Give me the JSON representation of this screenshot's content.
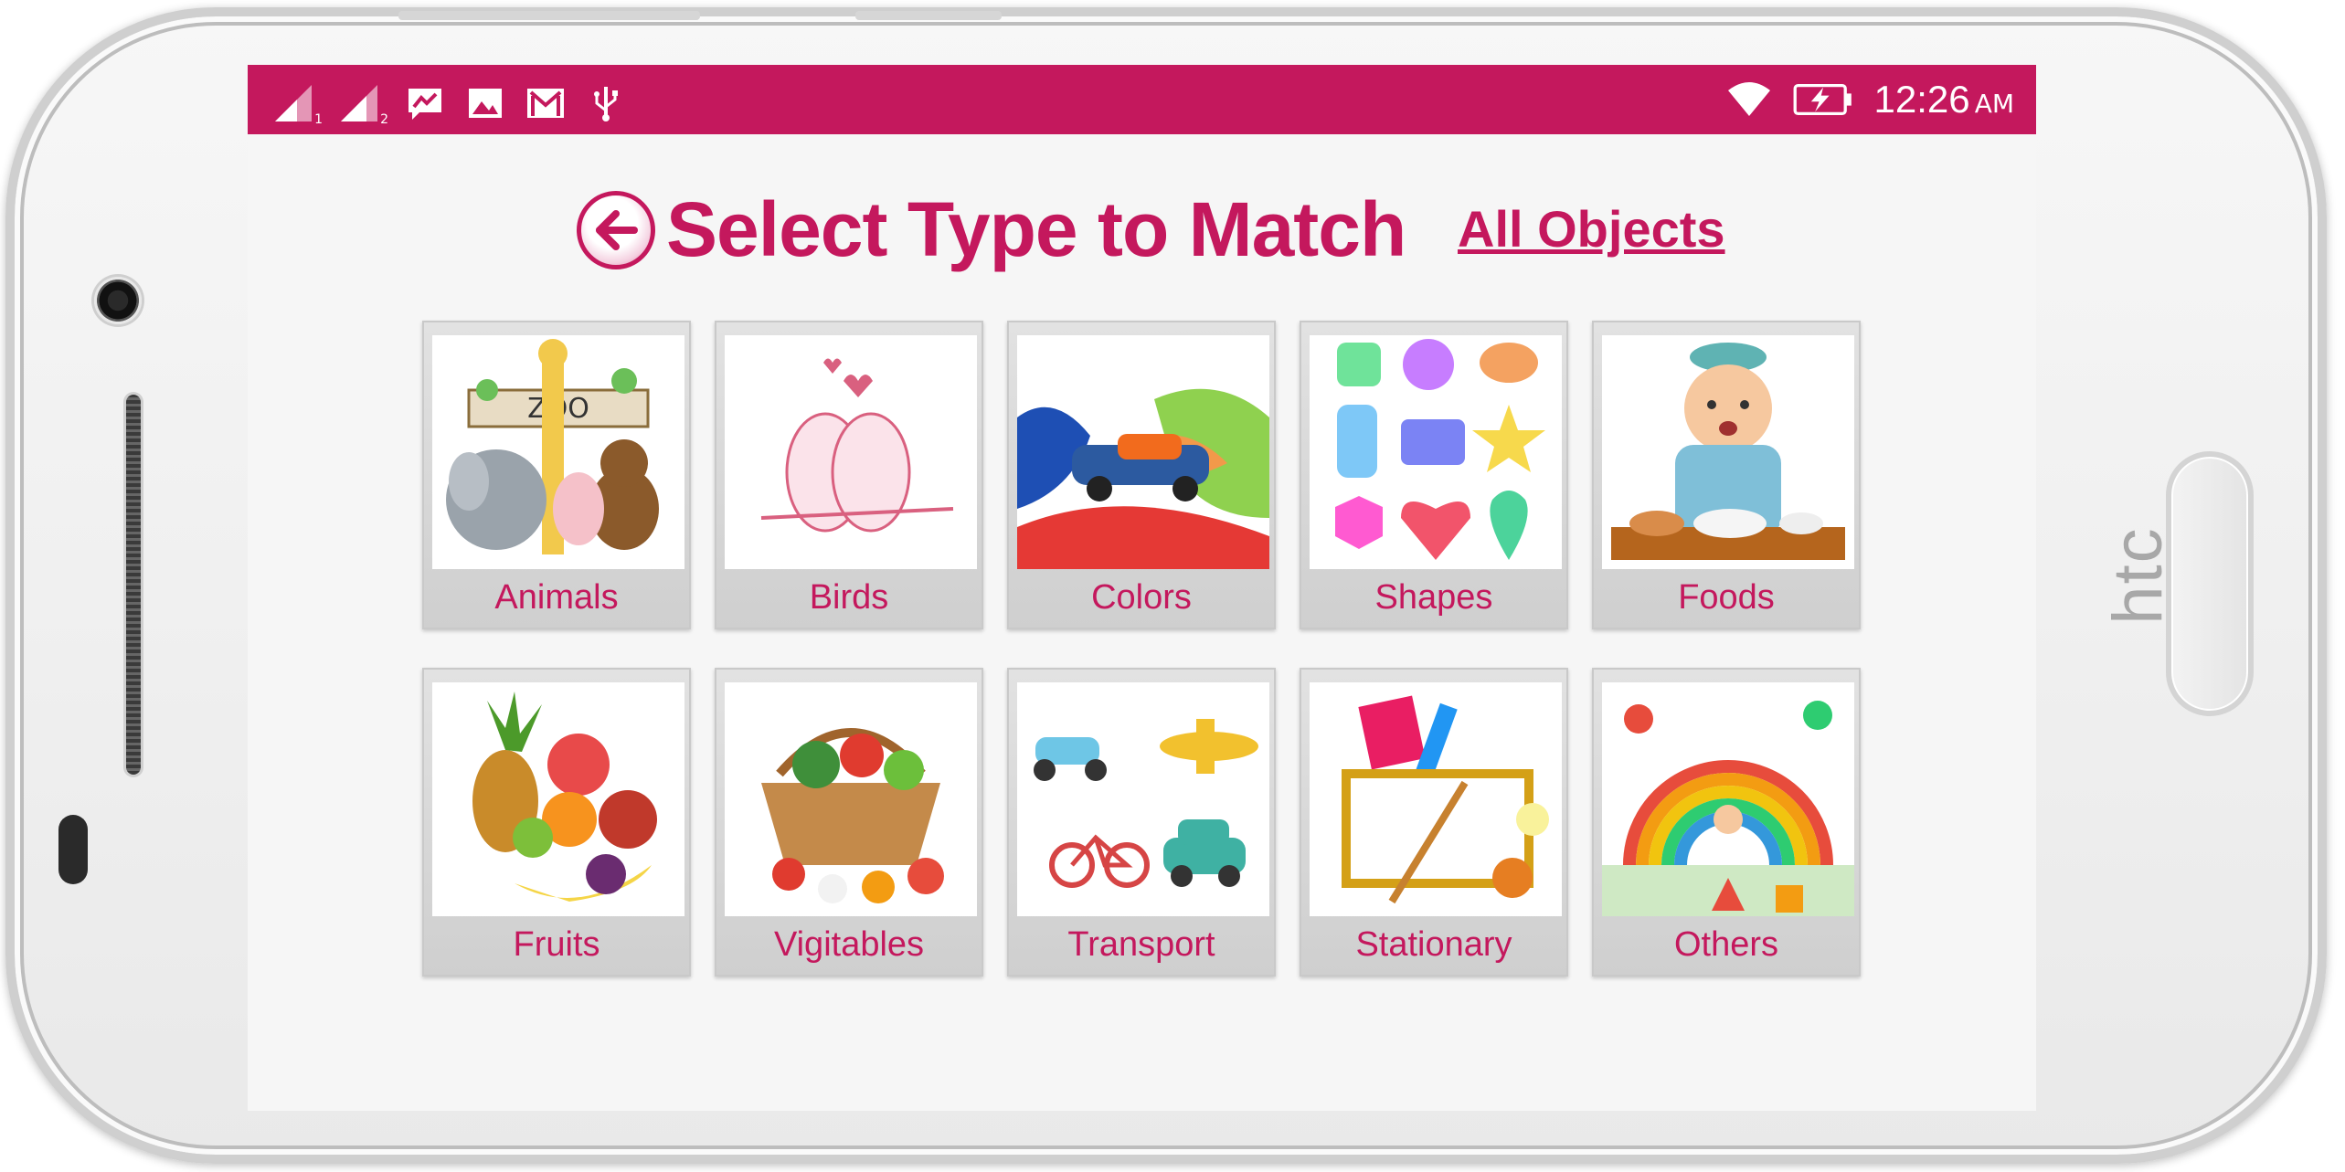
{
  "device": {
    "brand": "htc"
  },
  "status_bar": {
    "background": "#c4185d",
    "sim1_label": "1",
    "sim2_label": "2",
    "icons": [
      "signal-sim1-icon",
      "signal-sim2-icon",
      "messenger-icon",
      "gallery-icon",
      "gmail-icon",
      "usb-icon",
      "wifi-icon",
      "battery-charging-icon"
    ],
    "time": "12:26",
    "ampm": "AM"
  },
  "header": {
    "title": "Select Type to Match",
    "all_objects_link": "All Objects",
    "accent": "#c4185d"
  },
  "categories": [
    {
      "label": "Animals",
      "icon": "zoo-animals-icon"
    },
    {
      "label": "Birds",
      "icon": "lovebirds-icon"
    },
    {
      "label": "Colors",
      "icon": "paint-splash-car-icon"
    },
    {
      "label": "Shapes",
      "icon": "shapes-icon"
    },
    {
      "label": "Foods",
      "icon": "boy-eating-icon"
    },
    {
      "label": "Fruits",
      "icon": "fruits-icon"
    },
    {
      "label": "Vigitables",
      "icon": "vegetable-basket-icon"
    },
    {
      "label": "Transport",
      "icon": "vehicles-icon"
    },
    {
      "label": "Stationary",
      "icon": "stationery-icon"
    },
    {
      "label": "Others",
      "icon": "rainbow-kids-icon"
    }
  ]
}
